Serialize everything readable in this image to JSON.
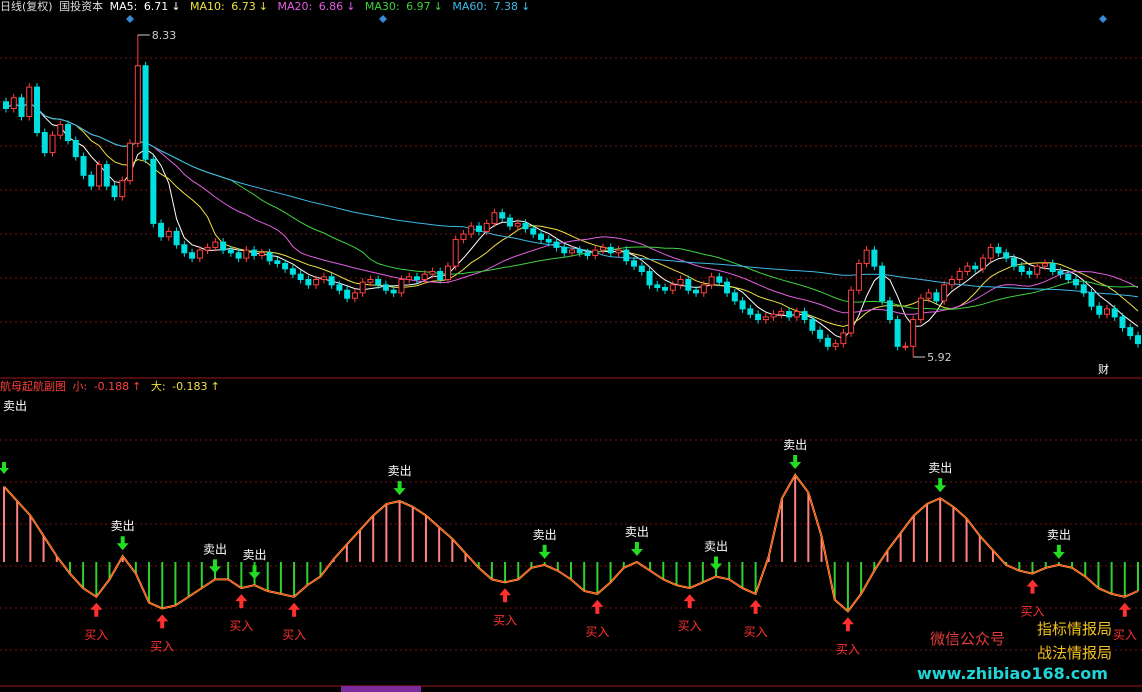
{
  "price_header": {
    "period": "日线(复权)",
    "stock": "国投资本",
    "ma": [
      {
        "name": "MA5: ",
        "value": "6.71",
        "arrow": "↓",
        "color": "#ffffff"
      },
      {
        "name": "MA10: ",
        "value": "6.73",
        "arrow": "↓",
        "color": "#f0e040"
      },
      {
        "name": "MA20: ",
        "value": "6.86",
        "arrow": "↓",
        "color": "#e060e0"
      },
      {
        "name": "MA30: ",
        "value": "6.97",
        "arrow": "↓",
        "color": "#40d040"
      },
      {
        "name": "MA60: ",
        "value": "7.38",
        "arrow": "↓",
        "color": "#40b8e8"
      }
    ]
  },
  "price_marks": {
    "high": "8.33",
    "low": "5.92",
    "cai": "财"
  },
  "indicator_header": {
    "title": "航母起航副图",
    "small_label": "小: ",
    "small_value": "-0.188",
    "small_arrow": "↑",
    "big_label": "大: ",
    "big_value": "-0.183",
    "big_arrow": "↑"
  },
  "signal_labels": {
    "sell": "卖出",
    "buy": "买入"
  },
  "watermark": {
    "wechat": "微信公众号",
    "brand1": "指标情报局",
    "brand2": "战法情报局",
    "site": "www.zhibiao168.com"
  },
  "colors": {
    "up": "#ff4040",
    "down": "#00e0e0",
    "osc_pos": "#ff8080",
    "osc_neg": "#30d030",
    "grid": "#7a1010"
  },
  "chart_data": {
    "type": "candlestick",
    "title": "国投资本",
    "price_high": 8.33,
    "price_low": 5.92,
    "close": [
      7.78,
      7.86,
      7.72,
      7.94,
      7.6,
      7.45,
      7.58,
      7.66,
      7.54,
      7.42,
      7.28,
      7.2,
      7.36,
      7.2,
      7.12,
      7.24,
      7.52,
      8.1,
      7.4,
      6.92,
      6.82,
      6.86,
      6.76,
      6.7,
      6.66,
      6.72,
      6.74,
      6.78,
      6.72,
      6.7,
      6.66,
      6.72,
      6.68,
      6.7,
      6.64,
      6.62,
      6.58,
      6.54,
      6.5,
      6.46,
      6.5,
      6.52,
      6.46,
      6.42,
      6.36,
      6.4,
      6.48,
      6.5,
      6.46,
      6.42,
      6.4,
      6.5,
      6.52,
      6.5,
      6.54,
      6.56,
      6.5,
      6.6,
      6.8,
      6.84,
      6.9,
      6.86,
      6.92,
      7.0,
      6.96,
      6.9,
      6.92,
      6.88,
      6.84,
      6.8,
      6.78,
      6.74,
      6.7,
      6.72,
      6.7,
      6.68,
      6.72,
      6.74,
      6.7,
      6.72,
      6.64,
      6.6,
      6.56,
      6.46,
      6.44,
      6.42,
      6.46,
      6.5,
      6.42,
      6.4,
      6.46,
      6.52,
      6.48,
      6.4,
      6.34,
      6.28,
      6.24,
      6.2,
      6.22,
      6.24,
      6.26,
      6.22,
      6.26,
      6.2,
      6.12,
      6.06,
      6.0,
      6.02,
      6.1,
      6.42,
      6.62,
      6.72,
      6.6,
      6.34,
      6.2,
      6.0,
      6.0,
      6.2,
      6.36,
      6.4,
      6.34,
      6.46,
      6.5,
      6.56,
      6.6,
      6.58,
      6.66,
      6.74,
      6.7,
      6.66,
      6.6,
      6.56,
      6.54,
      6.6,
      6.62,
      6.56,
      6.54,
      6.5,
      6.46,
      6.4,
      6.3,
      6.24,
      6.28,
      6.22,
      6.14,
      6.08,
      6.02
    ],
    "indicator_values": [
      2.6,
      2.1,
      1.6,
      0.9,
      0.2,
      -0.4,
      -0.9,
      -1.2,
      -0.6,
      0.2,
      -0.4,
      -1.4,
      -1.6,
      -1.5,
      -1.2,
      -0.9,
      -0.6,
      -0.6,
      -0.9,
      -0.8,
      -1.0,
      -1.1,
      -1.2,
      -0.8,
      -0.5,
      0.1,
      0.6,
      1.1,
      1.6,
      2.0,
      2.1,
      1.9,
      1.6,
      1.2,
      0.8,
      0.3,
      -0.2,
      -0.6,
      -0.7,
      -0.6,
      -0.2,
      -0.1,
      -0.3,
      -0.6,
      -1.0,
      -1.1,
      -0.7,
      -0.2,
      0.0,
      -0.3,
      -0.6,
      -0.8,
      -0.9,
      -0.7,
      -0.5,
      -0.6,
      -0.9,
      -1.1,
      0.2,
      2.2,
      3.0,
      2.4,
      0.9,
      -1.3,
      -1.7,
      -1.1,
      -0.3,
      0.4,
      1.0,
      1.6,
      2.0,
      2.2,
      1.9,
      1.5,
      0.9,
      0.4,
      -0.1,
      -0.3,
      -0.4,
      -0.2,
      -0.1,
      -0.2,
      -0.5,
      -0.9,
      -1.1,
      -1.2,
      -1.0
    ]
  }
}
